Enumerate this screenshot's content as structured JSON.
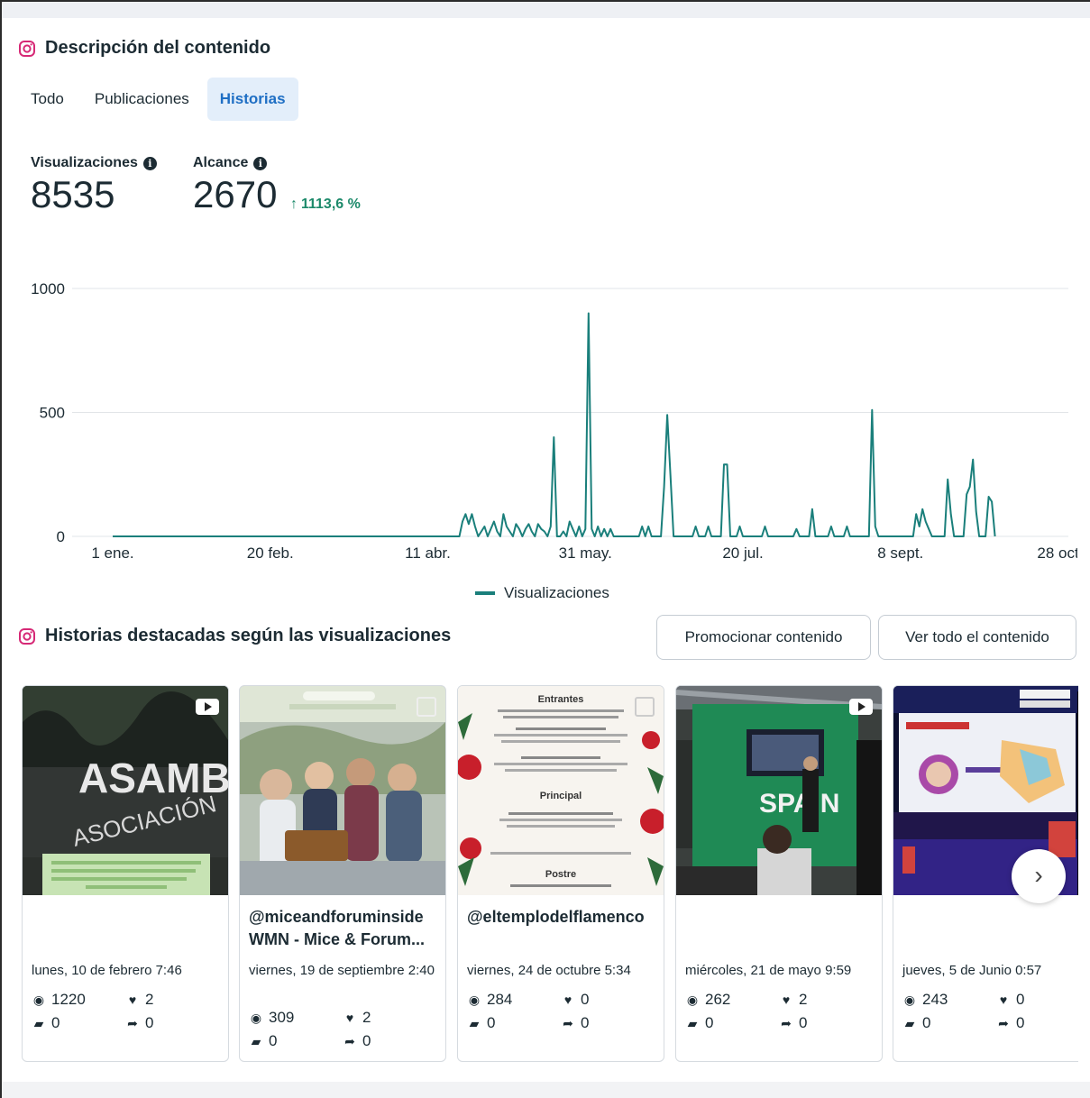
{
  "section1": {
    "title": "Descripción del contenido",
    "icon": "instagram-icon"
  },
  "tabs": [
    {
      "label": "Todo",
      "active": false
    },
    {
      "label": "Publicaciones",
      "active": false
    },
    {
      "label": "Historias",
      "active": true
    }
  ],
  "metrics": {
    "views_label": "Visualizaciones",
    "views_value": "8535",
    "reach_label": "Alcance",
    "reach_value": "2670",
    "reach_delta_arrow": "↑",
    "reach_delta": "1113,6 %"
  },
  "chart_data": {
    "type": "line",
    "title": "",
    "xlabel": "",
    "ylabel": "",
    "ylim": [
      0,
      1000
    ],
    "yticks": [
      "0",
      "500",
      "1000"
    ],
    "xticks": [
      {
        "label": "1 ene.",
        "day": 0
      },
      {
        "label": "20 feb.",
        "day": 50
      },
      {
        "label": "11 abr.",
        "day": 100
      },
      {
        "label": "31 may.",
        "day": 150
      },
      {
        "label": "20 jul.",
        "day": 200
      },
      {
        "label": "8 sept.",
        "day": 250
      },
      {
        "label": "28 oct",
        "day": 300
      }
    ],
    "legend": "bottom-center",
    "grid": true,
    "color": "#1a7f7b",
    "series": [
      {
        "name": "Visualizaciones",
        "points": [
          [
            0,
            0
          ],
          [
            110,
            0
          ],
          [
            111,
            60
          ],
          [
            112,
            90
          ],
          [
            113,
            50
          ],
          [
            114,
            90
          ],
          [
            115,
            40
          ],
          [
            116,
            0
          ],
          [
            118,
            40
          ],
          [
            119,
            0
          ],
          [
            121,
            60
          ],
          [
            122,
            20
          ],
          [
            123,
            0
          ],
          [
            124,
            90
          ],
          [
            125,
            40
          ],
          [
            126,
            20
          ],
          [
            127,
            0
          ],
          [
            128,
            50
          ],
          [
            129,
            30
          ],
          [
            130,
            0
          ],
          [
            131,
            30
          ],
          [
            132,
            50
          ],
          [
            133,
            20
          ],
          [
            134,
            0
          ],
          [
            135,
            50
          ],
          [
            136,
            30
          ],
          [
            137,
            20
          ],
          [
            138,
            0
          ],
          [
            139,
            40
          ],
          [
            140,
            400
          ],
          [
            141,
            0
          ],
          [
            142,
            0
          ],
          [
            143,
            20
          ],
          [
            144,
            0
          ],
          [
            145,
            60
          ],
          [
            146,
            30
          ],
          [
            147,
            0
          ],
          [
            148,
            40
          ],
          [
            149,
            0
          ],
          [
            150,
            30
          ],
          [
            151,
            900
          ],
          [
            152,
            30
          ],
          [
            153,
            0
          ],
          [
            154,
            40
          ],
          [
            155,
            0
          ],
          [
            156,
            30
          ],
          [
            157,
            0
          ],
          [
            158,
            30
          ],
          [
            159,
            0
          ],
          [
            160,
            0
          ],
          [
            167,
            0
          ],
          [
            168,
            40
          ],
          [
            169,
            0
          ],
          [
            170,
            40
          ],
          [
            171,
            0
          ],
          [
            174,
            0
          ],
          [
            175,
            200
          ],
          [
            176,
            490
          ],
          [
            177,
            250
          ],
          [
            178,
            0
          ],
          [
            179,
            0
          ],
          [
            184,
            0
          ],
          [
            185,
            40
          ],
          [
            186,
            0
          ],
          [
            188,
            0
          ],
          [
            189,
            40
          ],
          [
            190,
            0
          ],
          [
            193,
            0
          ],
          [
            194,
            290
          ],
          [
            195,
            290
          ],
          [
            196,
            0
          ],
          [
            198,
            0
          ],
          [
            199,
            40
          ],
          [
            200,
            0
          ],
          [
            206,
            0
          ],
          [
            207,
            40
          ],
          [
            208,
            0
          ],
          [
            216,
            0
          ],
          [
            217,
            30
          ],
          [
            218,
            0
          ],
          [
            221,
            0
          ],
          [
            222,
            110
          ],
          [
            223,
            0
          ],
          [
            227,
            0
          ],
          [
            228,
            40
          ],
          [
            229,
            0
          ],
          [
            232,
            0
          ],
          [
            233,
            40
          ],
          [
            234,
            0
          ],
          [
            240,
            0
          ],
          [
            241,
            510
          ],
          [
            242,
            40
          ],
          [
            243,
            0
          ],
          [
            254,
            0
          ],
          [
            255,
            90
          ],
          [
            256,
            40
          ],
          [
            257,
            110
          ],
          [
            258,
            60
          ],
          [
            259,
            30
          ],
          [
            260,
            0
          ],
          [
            264,
            0
          ],
          [
            265,
            230
          ],
          [
            266,
            90
          ],
          [
            267,
            0
          ],
          [
            270,
            0
          ],
          [
            271,
            170
          ],
          [
            272,
            200
          ],
          [
            273,
            310
          ],
          [
            274,
            100
          ],
          [
            275,
            0
          ],
          [
            277,
            0
          ],
          [
            278,
            160
          ],
          [
            279,
            140
          ],
          [
            280,
            0
          ]
        ]
      }
    ]
  },
  "section2": {
    "title": "Historias destacadas según las visualizaciones",
    "icon": "instagram-icon"
  },
  "buttons": {
    "promote": "Promocionar contenido",
    "view_all": "Ver todo el contenido"
  },
  "cards": [
    {
      "handle": "",
      "subtitle": "",
      "date": "lunes, 10 de febrero 7:46",
      "views": "1220",
      "likes": "2",
      "comments": "0",
      "shares": "0",
      "media": "video",
      "thumb_text_1": "ASAMB",
      "thumb_text_2": "ASOCIACIÓN"
    },
    {
      "handle": "@miceandforuminside",
      "subtitle": "WMN - Mice & Forum...",
      "date": "viernes, 19 de septiembre 2:40",
      "views": "309",
      "likes": "2",
      "comments": "0",
      "shares": "0",
      "media": "image"
    },
    {
      "handle": "@eltemplodelflamenco",
      "subtitle": "",
      "date": "viernes, 24 de octubre 5:34",
      "views": "284",
      "likes": "0",
      "comments": "0",
      "shares": "0",
      "media": "image",
      "thumb_text_1": "Entrantes",
      "thumb_text_2": "Principal",
      "thumb_text_3": "Postre"
    },
    {
      "handle": "",
      "subtitle": "",
      "date": "miércoles, 21 de mayo 9:59",
      "views": "262",
      "likes": "2",
      "comments": "0",
      "shares": "0",
      "media": "video",
      "thumb_text_1": "SPAIN"
    },
    {
      "handle": "",
      "subtitle": "",
      "date": "jueves, 5 de Junio 0:57",
      "views": "243",
      "likes": "0",
      "comments": "0",
      "shares": "0",
      "media": "video"
    }
  ],
  "icons": {
    "views": "eye-icon",
    "likes": "heart-icon",
    "comments": "comment-icon",
    "shares": "share-icon",
    "next": "chevron-right-icon"
  }
}
